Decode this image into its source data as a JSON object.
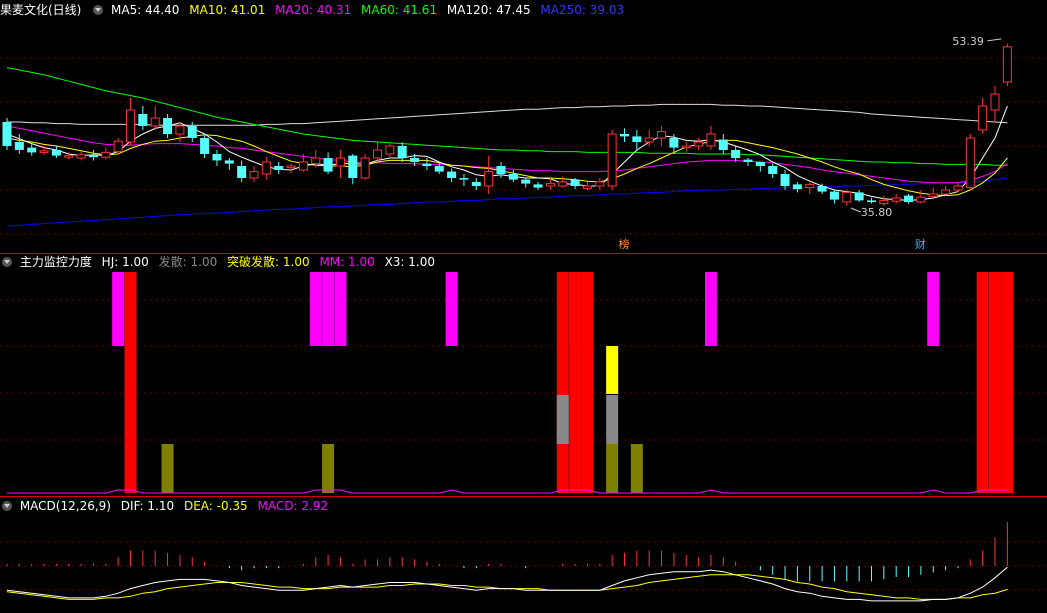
{
  "panel1": {
    "title": "果麦文化(日线)",
    "ma": [
      {
        "label": "MA5: 44.40",
        "color": "#ffffff"
      },
      {
        "label": "MA10: 41.01",
        "color": "#ffff00"
      },
      {
        "label": "MA20: 40.31",
        "color": "#ff00ff"
      },
      {
        "label": "MA60: 41.61",
        "color": "#00ff00"
      },
      {
        "label": "MA120: 47.45",
        "color": "#ffffff"
      },
      {
        "label": "MA250: 39.03",
        "color": "#0000ff"
      }
    ],
    "high_label": "53.39",
    "low_label": "35.80",
    "markers": [
      "榜",
      "财"
    ]
  },
  "panel2": {
    "title": "主力监控力度",
    "items": [
      {
        "label": "HJ: 1.00",
        "color": "#ffffff"
      },
      {
        "label": "发散: 1.00",
        "color": "#888888"
      },
      {
        "label": "突破发散: 1.00",
        "color": "#ffff00"
      },
      {
        "label": "MM: 1.00",
        "color": "#ff00ff"
      },
      {
        "label": "X3: 1.00",
        "color": "#ffffff"
      }
    ]
  },
  "panel3": {
    "title": "MACD(12,26,9)",
    "items": [
      {
        "label": "DIF: 1.10",
        "color": "#ffffff"
      },
      {
        "label": "DEA: -0.35",
        "color": "#ffff00"
      },
      {
        "label": "MACD: 2.92",
        "color": "#ff00ff"
      }
    ]
  },
  "chart_data": {
    "type": "candlestick",
    "colors": {
      "up": "#ff3232",
      "down": "#54ffff",
      "ma5": "#ffffff",
      "ma10": "#ffff00",
      "ma20": "#ff00ff",
      "ma60": "#00ff00",
      "ma120": "#dddddd",
      "ma250": "#0000ff"
    },
    "candles": [
      [
        44.0,
        41.0,
        44.5,
        40.5
      ],
      [
        41.5,
        40.5,
        42.5,
        40.0
      ],
      [
        40.8,
        40.2,
        41.2,
        39.8
      ],
      [
        40.2,
        40.4,
        41.0,
        39.9
      ],
      [
        40.5,
        39.8,
        41.0,
        39.5
      ],
      [
        39.6,
        39.8,
        40.2,
        39.3
      ],
      [
        39.5,
        39.9,
        40.3,
        39.2
      ],
      [
        39.9,
        39.6,
        40.5,
        39.2
      ],
      [
        39.6,
        40.2,
        40.8,
        39.3
      ],
      [
        40.3,
        41.6,
        42.0,
        40.0
      ],
      [
        41.5,
        45.5,
        47.0,
        41.0
      ],
      [
        45.0,
        43.5,
        46.0,
        43.0
      ],
      [
        43.5,
        44.5,
        46.0,
        43.0
      ],
      [
        44.5,
        42.5,
        45.0,
        42.0
      ],
      [
        42.5,
        43.5,
        44.0,
        41.5
      ],
      [
        43.5,
        42.0,
        44.0,
        41.5
      ],
      [
        42.0,
        40.0,
        42.5,
        39.5
      ],
      [
        40.0,
        39.2,
        40.5,
        38.5
      ],
      [
        39.2,
        38.8,
        39.5,
        38.0
      ],
      [
        38.5,
        37.0,
        39.2,
        36.5
      ],
      [
        37.0,
        37.8,
        38.5,
        36.5
      ],
      [
        37.5,
        39.0,
        39.6,
        36.8
      ],
      [
        38.5,
        38.0,
        39.0,
        37.5
      ],
      [
        38.3,
        38.5,
        38.8,
        37.6
      ],
      [
        38.0,
        39.0,
        40.0,
        37.8
      ],
      [
        38.8,
        39.5,
        40.5,
        38.3
      ],
      [
        39.5,
        37.8,
        40.2,
        37.5
      ],
      [
        38.5,
        39.5,
        40.5,
        37.0
      ],
      [
        39.8,
        37.0,
        40.0,
        36.2
      ],
      [
        37.0,
        39.5,
        40.0,
        36.8
      ],
      [
        39.5,
        40.5,
        41.5,
        39.0
      ],
      [
        40.0,
        41.0,
        41.5,
        39.5
      ],
      [
        41.0,
        39.5,
        41.5,
        39.0
      ],
      [
        39.5,
        39.0,
        40.0,
        38.5
      ],
      [
        38.8,
        38.5,
        39.5,
        38.0
      ],
      [
        38.5,
        37.8,
        39.0,
        37.5
      ],
      [
        37.8,
        37.0,
        38.2,
        36.5
      ],
      [
        37.0,
        36.8,
        37.5,
        36.0
      ],
      [
        36.5,
        36.0,
        37.0,
        35.5
      ],
      [
        36.0,
        37.8,
        39.8,
        35.0
      ],
      [
        38.5,
        37.5,
        39.0,
        37.0
      ],
      [
        37.5,
        36.8,
        38.0,
        36.5
      ],
      [
        36.8,
        36.3,
        37.0,
        35.8
      ],
      [
        36.2,
        35.8,
        36.5,
        35.5
      ],
      [
        36.0,
        36.3,
        37.0,
        35.5
      ],
      [
        36.0,
        36.5,
        37.2,
        35.8
      ],
      [
        36.8,
        36.0,
        37.0,
        35.6
      ],
      [
        35.7,
        36.0,
        36.5,
        35.5
      ],
      [
        36.0,
        36.5,
        37.0,
        35.5
      ],
      [
        36.0,
        42.5,
        43.0,
        35.5
      ],
      [
        42.5,
        42.2,
        43.2,
        41.5
      ],
      [
        42.2,
        41.5,
        43.0,
        40.5
      ],
      [
        41.5,
        42.0,
        43.0,
        41.0
      ],
      [
        42.0,
        42.8,
        43.5,
        41.0
      ],
      [
        42.0,
        40.8,
        42.5,
        40.0
      ],
      [
        40.8,
        41.0,
        41.5,
        40.3
      ],
      [
        41.0,
        41.5,
        42.0,
        40.5
      ],
      [
        41.0,
        42.5,
        43.5,
        40.5
      ],
      [
        41.8,
        40.5,
        42.5,
        40.0
      ],
      [
        40.5,
        39.5,
        41.0,
        39.0
      ],
      [
        39.3,
        39.0,
        39.5,
        38.5
      ],
      [
        39.0,
        38.5,
        39.0,
        37.8
      ],
      [
        38.5,
        37.5,
        38.8,
        37.0
      ],
      [
        37.5,
        36.0,
        38.0,
        35.5
      ],
      [
        36.2,
        35.6,
        36.5,
        35.2
      ],
      [
        35.8,
        36.2,
        36.8,
        35.0
      ],
      [
        36.0,
        35.3,
        36.3,
        35.0
      ],
      [
        35.3,
        34.3,
        35.5,
        33.8
      ],
      [
        34.0,
        35.2,
        35.5,
        33.5
      ],
      [
        35.2,
        34.2,
        35.5,
        34.0
      ],
      [
        34.2,
        34.0,
        34.5,
        33.8
      ],
      [
        33.8,
        34.2,
        34.8,
        33.5
      ],
      [
        34.1,
        34.5,
        35.0,
        33.8
      ],
      [
        34.8,
        34.0,
        35.0,
        33.8
      ],
      [
        34.0,
        34.6,
        35.5,
        33.8
      ],
      [
        34.7,
        35.0,
        35.8,
        34.5
      ],
      [
        35.0,
        35.5,
        36.0,
        34.8
      ],
      [
        35.5,
        36.0,
        36.5,
        35.2
      ],
      [
        35.8,
        42.0,
        42.5,
        35.5
      ],
      [
        43.0,
        46.0,
        47.0,
        42.5
      ],
      [
        45.5,
        47.5,
        48.5,
        44.0
      ],
      [
        49.0,
        53.39,
        53.8,
        48.5
      ]
    ],
    "ma5": [
      42.5,
      41.9,
      41.3,
      40.8,
      40.5,
      40.0,
      39.8,
      39.9,
      39.8,
      40.3,
      41.6,
      42.5,
      43.2,
      43.5,
      43.9,
      43.2,
      42.5,
      41.5,
      40.3,
      39.6,
      39.0,
      38.4,
      38.1,
      38.0,
      38.5,
      38.8,
      38.6,
      38.8,
      38.8,
      38.7,
      39.2,
      39.5,
      39.5,
      39.8,
      39.7,
      39.0,
      38.4,
      38.0,
      37.4,
      37.2,
      37.4,
      37.2,
      37.0,
      37.0,
      36.9,
      36.3,
      36.2,
      36.0,
      36.0,
      37.5,
      39.0,
      40.5,
      41.5,
      42.3,
      42.1,
      41.7,
      41.6,
      41.8,
      41.5,
      41.0,
      40.5,
      39.9,
      39.0,
      38.3,
      37.3,
      36.6,
      36.0,
      35.5,
      35.3,
      35.1,
      34.7,
      34.4,
      34.3,
      34.2,
      34.3,
      34.5,
      34.9,
      35.3,
      37.0,
      39.5,
      42.0,
      46.0
    ],
    "ma10": [
      42.0,
      41.7,
      41.5,
      41.2,
      41.0,
      40.7,
      40.4,
      40.1,
      39.9,
      40.0,
      40.7,
      41.2,
      41.6,
      41.7,
      42.0,
      42.2,
      42.4,
      42.3,
      41.9,
      41.6,
      41.0,
      40.3,
      39.7,
      39.1,
      38.8,
      38.6,
      38.5,
      38.5,
      38.4,
      38.6,
      39.0,
      39.2,
      39.2,
      39.2,
      39.2,
      38.9,
      38.6,
      38.5,
      38.3,
      38.2,
      37.9,
      37.6,
      37.3,
      37.0,
      37.0,
      36.9,
      36.8,
      36.6,
      36.5,
      36.9,
      37.5,
      38.2,
      38.8,
      39.5,
      40.2,
      40.9,
      41.2,
      41.6,
      41.7,
      41.7,
      41.4,
      41.1,
      40.8,
      40.4,
      40.0,
      39.5,
      39.0,
      38.4,
      37.9,
      37.5,
      36.8,
      36.2,
      35.8,
      35.4,
      35.1,
      34.9,
      34.8,
      34.9,
      35.5,
      36.4,
      37.6,
      39.5
    ],
    "ma20": [
      43.5,
      43.2,
      42.9,
      42.6,
      42.3,
      42.0,
      41.7,
      41.4,
      41.2,
      41.1,
      41.1,
      41.2,
      41.3,
      41.3,
      41.3,
      41.2,
      41.1,
      41.0,
      40.8,
      40.7,
      40.5,
      40.3,
      40.1,
      39.9,
      39.7,
      39.5,
      39.3,
      39.2,
      39.0,
      38.9,
      38.9,
      38.8,
      38.8,
      38.8,
      38.7,
      38.7,
      38.6,
      38.5,
      38.4,
      38.3,
      38.2,
      38.1,
      38.0,
      37.9,
      37.9,
      37.8,
      37.8,
      37.8,
      37.8,
      37.9,
      38.0,
      38.2,
      38.4,
      38.6,
      38.8,
      39.0,
      39.1,
      39.2,
      39.2,
      39.2,
      39.1,
      39.0,
      38.9,
      38.7,
      38.5,
      38.3,
      38.0,
      37.8,
      37.6,
      37.4,
      37.2,
      37.0,
      36.8,
      36.6,
      36.5,
      36.4,
      36.4,
      36.4,
      36.7,
      37.2,
      37.8,
      38.8
    ],
    "ma60": [
      50.8,
      50.5,
      50.2,
      49.9,
      49.5,
      49.1,
      48.7,
      48.3,
      47.9,
      47.6,
      47.3,
      47.0,
      46.6,
      46.2,
      45.8,
      45.4,
      45.0,
      44.6,
      44.3,
      44.0,
      43.7,
      43.4,
      43.1,
      42.8,
      42.5,
      42.3,
      42.1,
      41.9,
      41.7,
      41.6,
      41.5,
      41.4,
      41.3,
      41.2,
      41.1,
      41.0,
      40.9,
      40.8,
      40.7,
      40.6,
      40.5,
      40.5,
      40.4,
      40.4,
      40.3,
      40.3,
      40.3,
      40.2,
      40.2,
      40.2,
      40.2,
      40.2,
      40.1,
      40.1,
      40.1,
      40.1,
      40.0,
      40.0,
      40.0,
      40.0,
      39.9,
      39.9,
      39.8,
      39.7,
      39.6,
      39.5,
      39.4,
      39.3,
      39.2,
      39.1,
      39.0,
      39.0,
      38.9,
      38.9,
      38.8,
      38.8,
      38.7,
      38.7,
      38.7,
      38.7,
      38.6,
      38.6
    ],
    "ma120": [
      44.0,
      44.0,
      43.9,
      43.9,
      43.8,
      43.8,
      43.7,
      43.7,
      43.7,
      43.7,
      43.7,
      43.7,
      43.6,
      43.6,
      43.6,
      43.6,
      43.6,
      43.6,
      43.6,
      43.6,
      43.6,
      43.7,
      43.7,
      43.8,
      43.8,
      43.9,
      44.0,
      44.1,
      44.2,
      44.3,
      44.4,
      44.5,
      44.6,
      44.7,
      44.8,
      44.9,
      45.0,
      45.1,
      45.2,
      45.3,
      45.4,
      45.5,
      45.6,
      45.6,
      45.7,
      45.8,
      45.8,
      45.9,
      45.9,
      46.0,
      46.0,
      46.1,
      46.1,
      46.2,
      46.2,
      46.2,
      46.2,
      46.2,
      46.1,
      46.1,
      46.0,
      46.0,
      45.9,
      45.8,
      45.7,
      45.6,
      45.5,
      45.4,
      45.3,
      45.2,
      45.0,
      44.9,
      44.8,
      44.7,
      44.6,
      44.5,
      44.4,
      44.3,
      44.2,
      44.1,
      44.0,
      43.9
    ],
    "ma250": [
      31.0,
      31.1,
      31.2,
      31.3,
      31.4,
      31.5,
      31.6,
      31.7,
      31.8,
      31.9,
      32.0,
      32.1,
      32.2,
      32.3,
      32.4,
      32.5,
      32.6,
      32.6,
      32.7,
      32.8,
      32.9,
      33.0,
      33.1,
      33.1,
      33.2,
      33.3,
      33.4,
      33.4,
      33.5,
      33.6,
      33.7,
      33.7,
      33.8,
      33.9,
      34.0,
      34.0,
      34.1,
      34.2,
      34.2,
      34.3,
      34.4,
      34.4,
      34.5,
      34.6,
      34.6,
      34.7,
      34.8,
      34.8,
      34.9,
      35.0,
      35.0,
      35.1,
      35.2,
      35.2,
      35.3,
      35.4,
      35.4,
      35.5,
      35.5,
      35.6,
      35.6,
      35.7,
      35.7,
      35.8,
      35.8,
      35.8,
      35.9,
      35.9,
      36.0,
      36.0,
      36.1,
      36.1,
      36.2,
      36.2,
      36.3,
      36.3,
      36.4,
      36.4,
      36.5,
      36.6,
      36.8,
      37.0
    ],
    "mm_bars": [
      9,
      25,
      26,
      27,
      36,
      46,
      57,
      75
    ],
    "hj_bars": [
      10,
      45,
      46,
      47,
      79,
      80,
      81
    ],
    "olive_bars": [
      13,
      26,
      49,
      51
    ],
    "gray_bars": [
      45,
      49
    ],
    "yellow_bars": [
      49
    ],
    "macd_hist": [
      0.1,
      0.1,
      0.1,
      0.1,
      0.1,
      0.1,
      0.1,
      0.1,
      0.1,
      0.4,
      0.7,
      0.7,
      0.7,
      0.6,
      0.5,
      0.4,
      0.2,
      0.0,
      -0.1,
      -0.2,
      -0.1,
      -0.1,
      -0.1,
      0.0,
      0.1,
      0.4,
      0.5,
      0.4,
      0.1,
      0.3,
      0.3,
      0.4,
      0.4,
      0.3,
      0.2,
      0.1,
      0.0,
      -0.1,
      -0.1,
      0.1,
      0.1,
      0.0,
      -0.1,
      0.0,
      0.0,
      0.1,
      0.1,
      0.1,
      0.1,
      0.5,
      0.6,
      0.7,
      0.7,
      0.7,
      0.6,
      0.5,
      0.4,
      0.5,
      0.4,
      0.2,
      0.0,
      -0.2,
      -0.4,
      -0.6,
      -0.7,
      -0.7,
      -0.7,
      -0.7,
      -0.7,
      -0.7,
      -0.7,
      -0.6,
      -0.5,
      -0.5,
      -0.4,
      -0.3,
      -0.2,
      -0.1,
      0.3,
      0.7,
      1.3,
      2.0
    ],
    "dif": [
      -0.4,
      -0.5,
      -0.6,
      -0.7,
      -0.8,
      -0.9,
      -0.9,
      -0.9,
      -0.8,
      -0.6,
      -0.3,
      -0.1,
      0.1,
      0.2,
      0.3,
      0.3,
      0.3,
      0.2,
      0.1,
      -0.1,
      -0.2,
      -0.3,
      -0.4,
      -0.4,
      -0.4,
      -0.3,
      -0.2,
      -0.1,
      -0.2,
      -0.1,
      0.0,
      0.1,
      0.1,
      0.1,
      0.0,
      -0.1,
      -0.2,
      -0.3,
      -0.4,
      -0.3,
      -0.3,
      -0.3,
      -0.4,
      -0.4,
      -0.4,
      -0.4,
      -0.4,
      -0.4,
      -0.4,
      -0.1,
      0.2,
      0.4,
      0.6,
      0.7,
      0.8,
      0.8,
      0.8,
      0.9,
      0.8,
      0.6,
      0.4,
      0.2,
      0.0,
      -0.3,
      -0.5,
      -0.6,
      -0.8,
      -0.9,
      -1.0,
      -1.0,
      -1.1,
      -1.1,
      -1.1,
      -1.1,
      -1.1,
      -1.0,
      -1.0,
      -0.9,
      -0.6,
      -0.2,
      0.4,
      1.1
    ],
    "dea": [
      -0.5,
      -0.6,
      -0.7,
      -0.8,
      -0.9,
      -1.0,
      -1.0,
      -1.0,
      -0.9,
      -0.9,
      -0.8,
      -0.6,
      -0.5,
      -0.3,
      -0.2,
      -0.1,
      0.0,
      0.1,
      0.1,
      0.1,
      0.0,
      -0.1,
      -0.2,
      -0.2,
      -0.3,
      -0.3,
      -0.3,
      -0.2,
      -0.2,
      -0.2,
      -0.2,
      -0.1,
      -0.1,
      0.0,
      0.0,
      0.0,
      -0.1,
      -0.1,
      -0.2,
      -0.2,
      -0.3,
      -0.3,
      -0.3,
      -0.3,
      -0.4,
      -0.4,
      -0.4,
      -0.4,
      -0.4,
      -0.3,
      -0.2,
      -0.1,
      0.1,
      0.2,
      0.3,
      0.4,
      0.5,
      0.6,
      0.6,
      0.6,
      0.6,
      0.5,
      0.4,
      0.3,
      0.1,
      0.0,
      -0.2,
      -0.3,
      -0.5,
      -0.6,
      -0.7,
      -0.8,
      -0.9,
      -0.9,
      -1.0,
      -1.0,
      -1.0,
      -0.9,
      -0.9,
      -0.7,
      -0.6,
      -0.35
    ]
  }
}
